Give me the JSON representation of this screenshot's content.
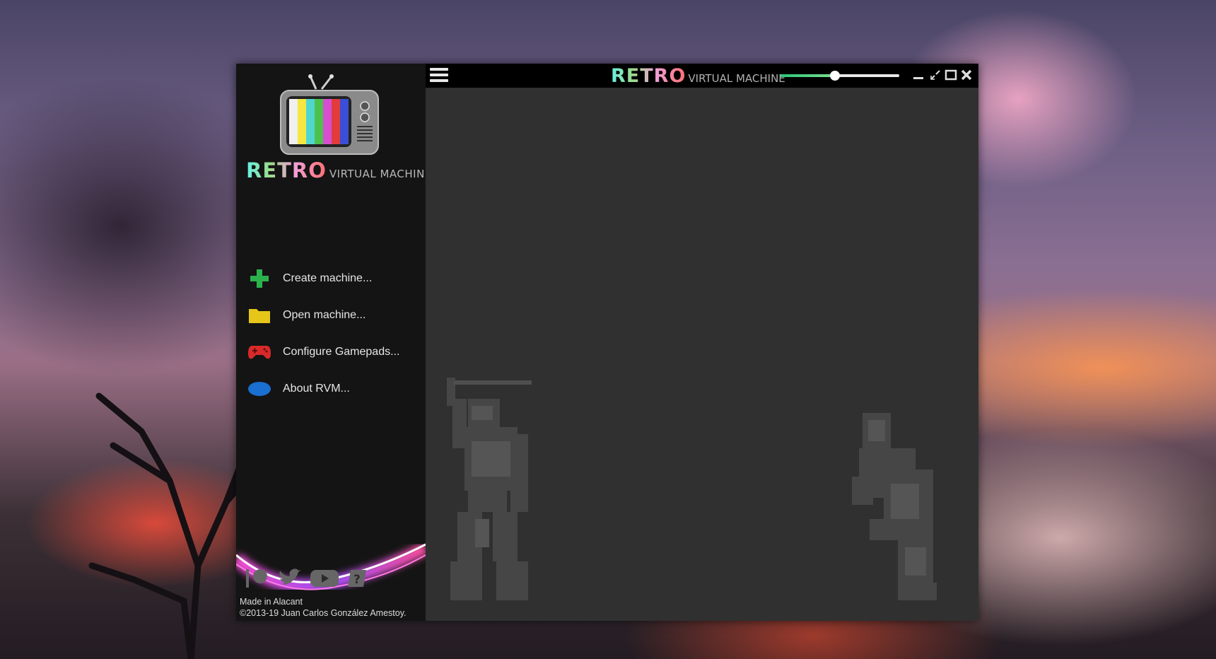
{
  "app": {
    "brand_retro": "RETRO",
    "brand_virtual_machine": "VIRTUAL MACHINE"
  },
  "sidebar": {
    "menu": [
      {
        "label": "Create machine...",
        "icon": "plus-icon",
        "color": "#2bb24c"
      },
      {
        "label": "Open machine...",
        "icon": "folder-icon",
        "color": "#e6c619"
      },
      {
        "label": "Configure Gamepads...",
        "icon": "gamepad-icon",
        "color": "#d82a2a"
      },
      {
        "label": "About RVM...",
        "icon": "info-oval-icon",
        "color": "#1a6fd1"
      }
    ],
    "social": [
      "patreon-icon",
      "twitter-icon",
      "youtube-icon",
      "help-icon"
    ],
    "footer_line1": "Made in Alacant",
    "footer_line2": "©2013-19 Juan Carlos González Amestoy."
  },
  "titlebar": {
    "volume_level": 0.46,
    "buttons": [
      "minimize-icon",
      "restore-icon",
      "maximize-icon",
      "close-icon"
    ]
  },
  "colors": {
    "window_bg": "#303030",
    "sidebar_bg": "#141414",
    "titlebar_bg": "#000000",
    "slider_fill": "#2bc47a"
  }
}
